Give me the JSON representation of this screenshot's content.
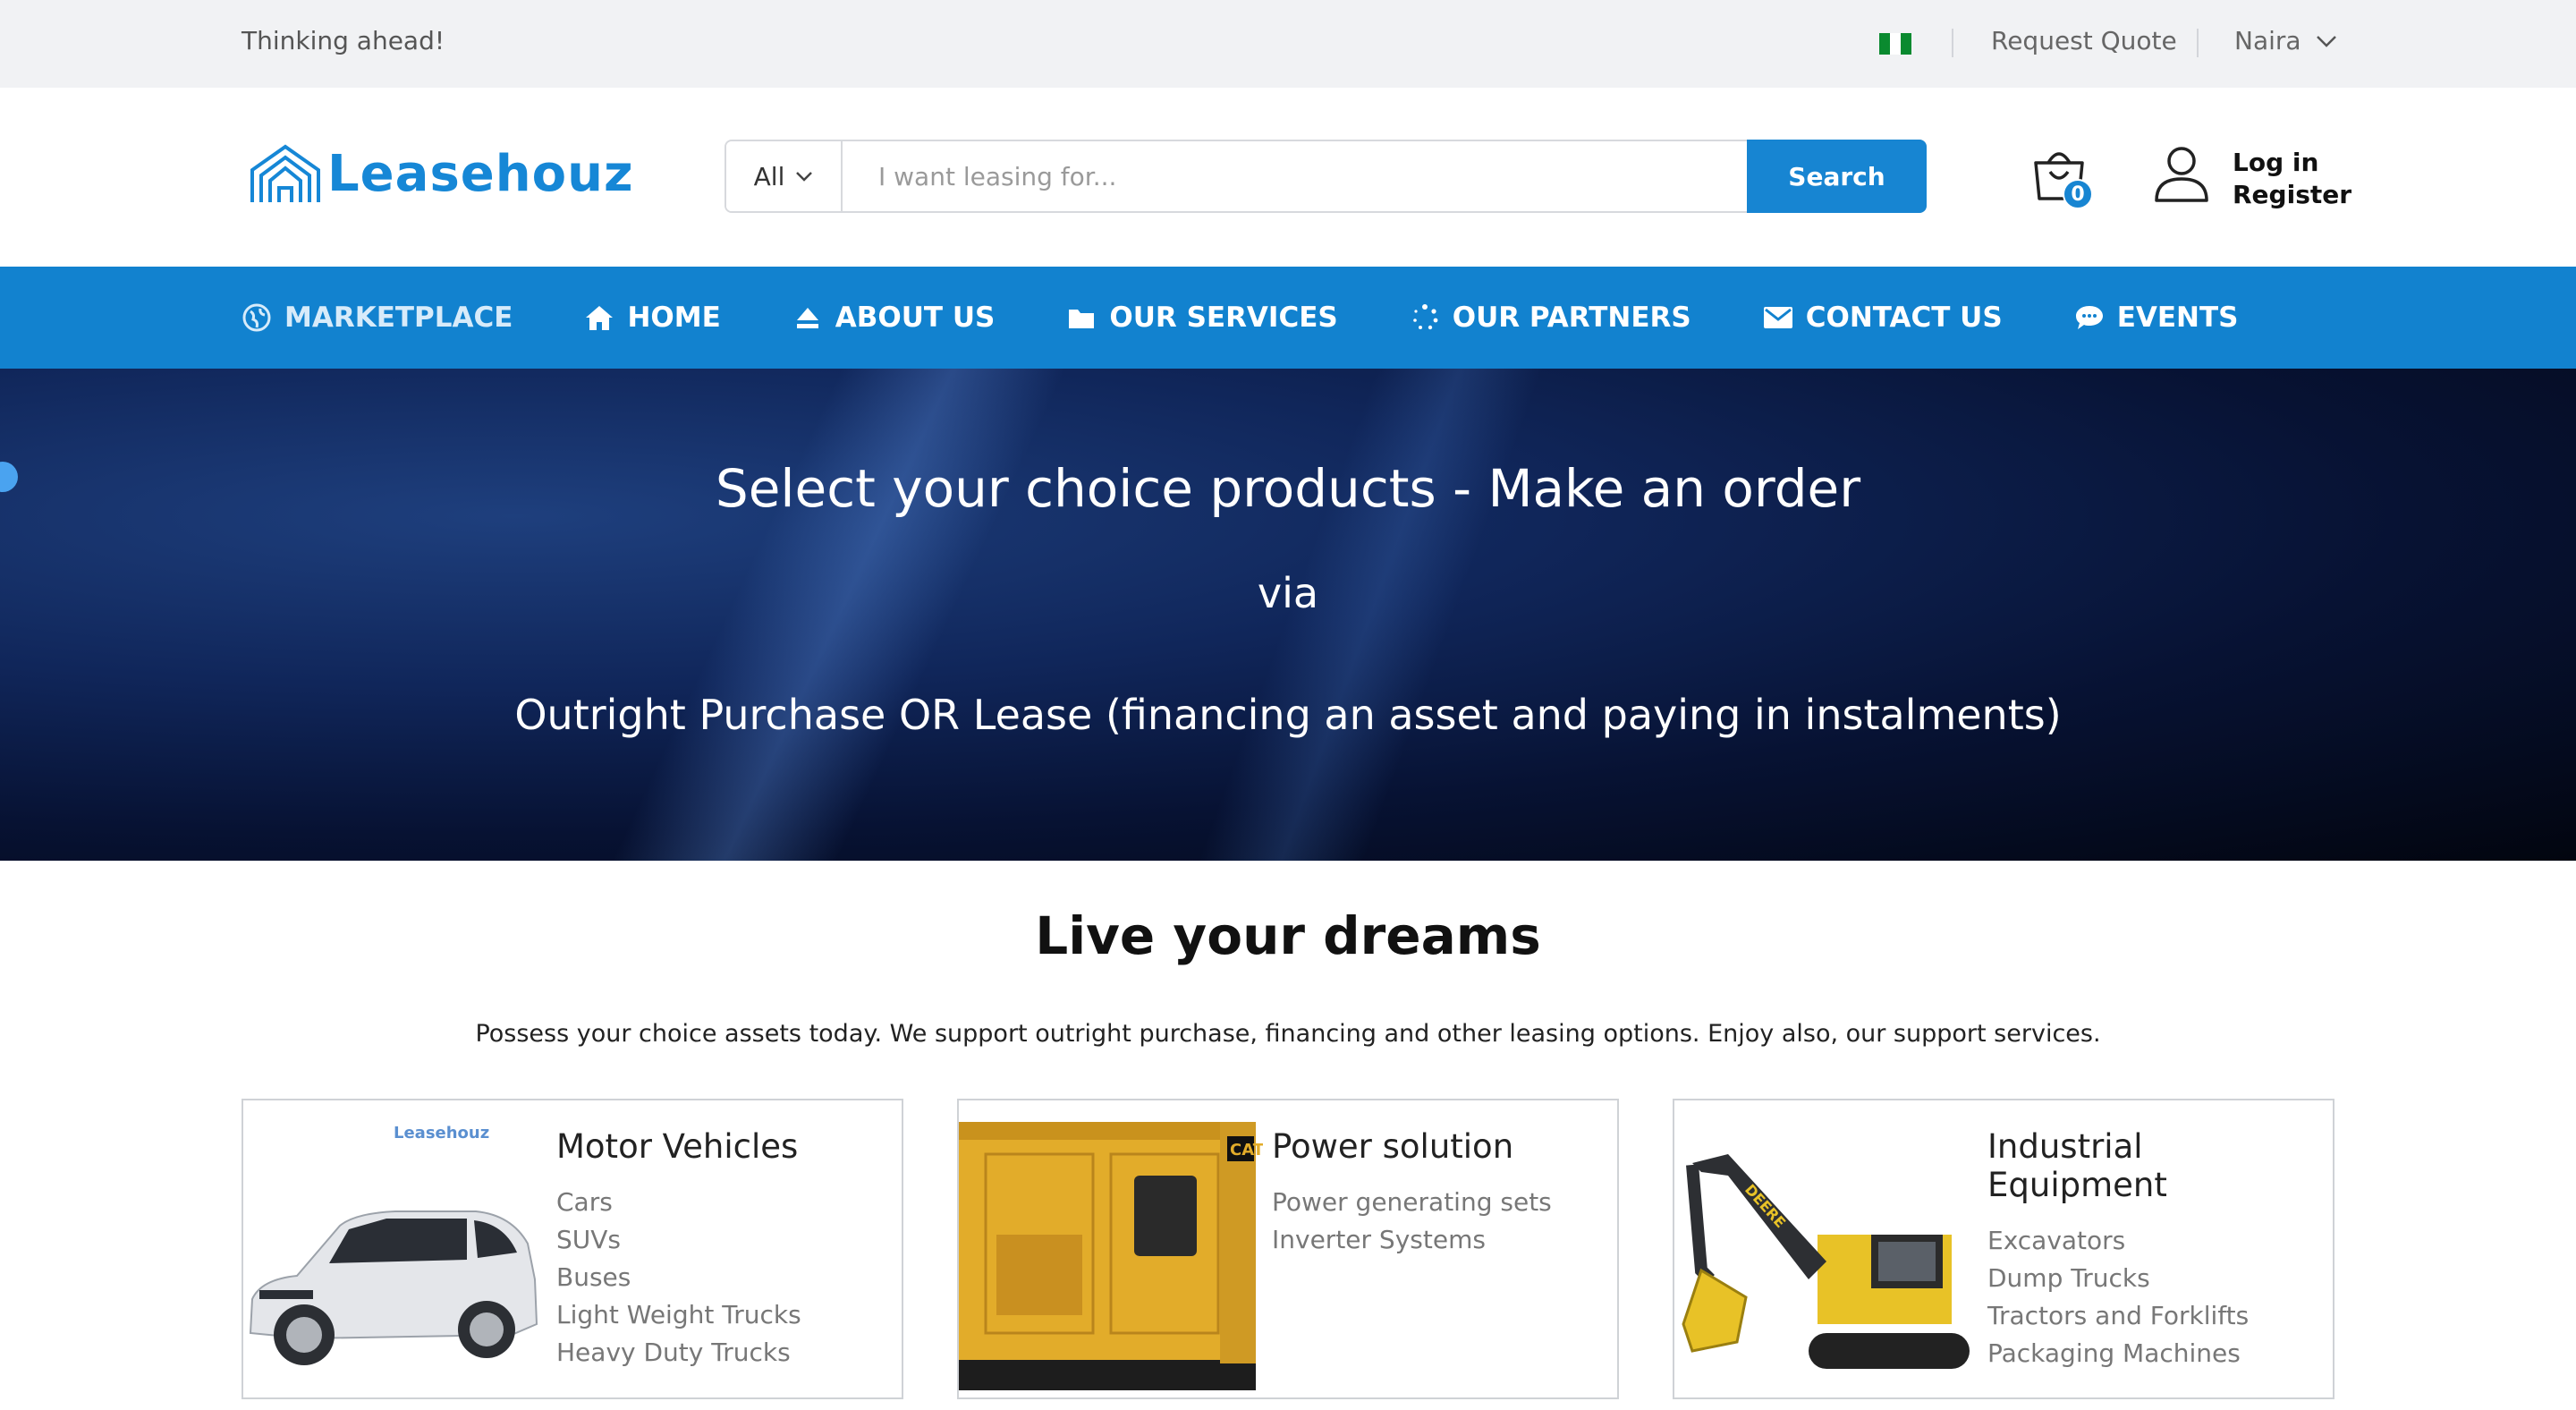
{
  "topbar": {
    "tagline": "Thinking ahead!",
    "request_quote": "Request Quote",
    "currency": "Naira",
    "flag_icon": "nigeria-flag-icon"
  },
  "header": {
    "logo_text": "Leasehouz",
    "category_select": "All",
    "search_placeholder": "I want leasing for...",
    "search_button": "Search",
    "cart_count": "0",
    "login": "Log in",
    "register": "Register"
  },
  "nav": {
    "items": [
      {
        "label": "MARKETPLACE",
        "icon": "globe-icon"
      },
      {
        "label": "HOME",
        "icon": "home-icon"
      },
      {
        "label": "ABOUT US",
        "icon": "eject-icon"
      },
      {
        "label": "OUR SERVICES",
        "icon": "folder-icon"
      },
      {
        "label": "OUR PARTNERS",
        "icon": "spinner-icon"
      },
      {
        "label": "CONTACT US",
        "icon": "envelope-icon"
      },
      {
        "label": "EVENTS",
        "icon": "chat-bubble-icon"
      }
    ]
  },
  "hero": {
    "line1": "Select your choice products - Make an order",
    "line2": "via",
    "line3": "Outright Purchase OR Lease (financing an asset and paying in instalments)"
  },
  "section": {
    "title": "Live your dreams",
    "subtitle": "Possess your choice assets today. We support outright purchase, financing and other leasing options. Enjoy also, our support services."
  },
  "cards": [
    {
      "title": "Motor Vehicles",
      "image_watermark": "Leasehouz",
      "items": [
        "Cars",
        "SUVs",
        "Buses",
        "Light Weight Trucks",
        "Heavy Duty Trucks"
      ]
    },
    {
      "title": "Power solution",
      "image_badge": "CAT",
      "items": [
        "Power generating sets",
        "Inverter Systems"
      ]
    },
    {
      "title": "Industrial Equipment",
      "image_badge": "DEERE",
      "items": [
        "Excavators",
        "Dump Trucks",
        "Tractors and Forklifts",
        "Packaging Machines"
      ]
    }
  ],
  "colors": {
    "brand_blue": "#1282cf",
    "topbar_bg": "#f1f2f4"
  }
}
